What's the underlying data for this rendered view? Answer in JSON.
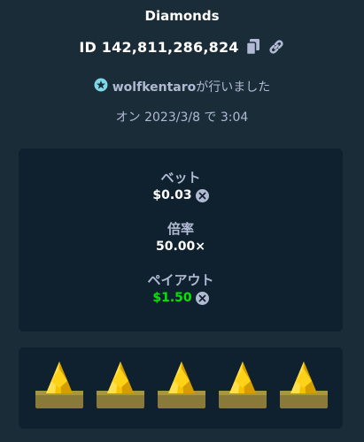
{
  "header": {
    "title": "Diamonds",
    "id_text": "ID 142,811,286,824"
  },
  "user": {
    "name": "wolfkentaro",
    "suffix": "が行いました"
  },
  "date": "オン 2023/3/8 で 3:04",
  "stats": {
    "bet_label": "ベット",
    "bet_value": "$0.03",
    "multiplier_label": "倍率",
    "multiplier_value": "50.00×",
    "payout_label": "ペイアウト",
    "payout_value": "$1.50"
  },
  "colors": {
    "background": "#1a2c38",
    "panel": "#0f212e",
    "muted_text": "#b1bad3",
    "payout_green": "#00e701",
    "gem_yellow": "#f5c400",
    "pedestal": "#8a7a3a"
  },
  "icons": {
    "copy": "copy-icon",
    "link": "link-icon",
    "user_rank": "star-icon",
    "currency": "coin-icon",
    "gem": "gem-icon"
  },
  "tiles": [
    {
      "gem": "yellow"
    },
    {
      "gem": "yellow"
    },
    {
      "gem": "yellow"
    },
    {
      "gem": "yellow"
    },
    {
      "gem": "yellow"
    }
  ]
}
